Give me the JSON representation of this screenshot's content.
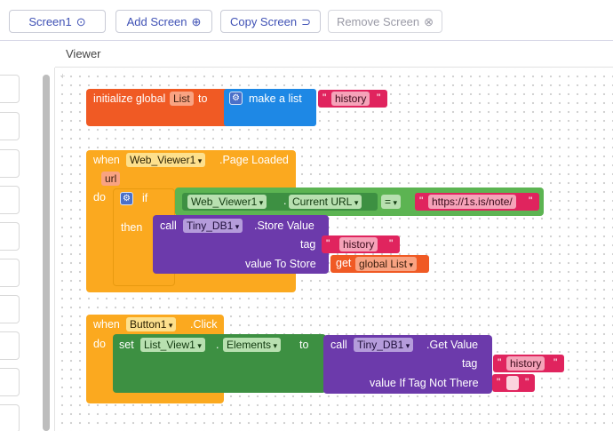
{
  "toolbar": {
    "screen_label": "Screen1",
    "add_screen": "Add Screen",
    "copy_screen": "Copy Screen",
    "remove_screen": "Remove Screen"
  },
  "viewer": {
    "title": "Viewer"
  },
  "blocks": {
    "init": {
      "label": "initialize global",
      "var": "List",
      "to": "to",
      "make_list": "make a list",
      "item": "history"
    },
    "when_web": {
      "when": "when",
      "component": "Web_Viewer1",
      "event": ".Page Loaded",
      "param": "url",
      "do": "do",
      "if": "if",
      "then": "then",
      "cond_component": "Web_Viewer1",
      "cond_property": "Current URL",
      "op": "=",
      "url_text": "https://1s.is/note/",
      "call": "call",
      "db": "Tiny_DB1",
      "method": ".Store Value",
      "tag_label": "tag",
      "tag_value": "history",
      "value_label": "value To Store",
      "get": "get",
      "get_var": "global List"
    },
    "when_button": {
      "when": "when",
      "component": "Button1",
      "event": ".Click",
      "do": "do",
      "set": "set",
      "set_component": "List_View1",
      "set_property": "Elements",
      "to": "to",
      "call": "call",
      "db": "Tiny_DB1",
      "method": ".Get Value",
      "tag_label": "tag",
      "tag_value": "history",
      "if_not_label": "value If Tag Not There",
      "empty_value": ""
    }
  }
}
